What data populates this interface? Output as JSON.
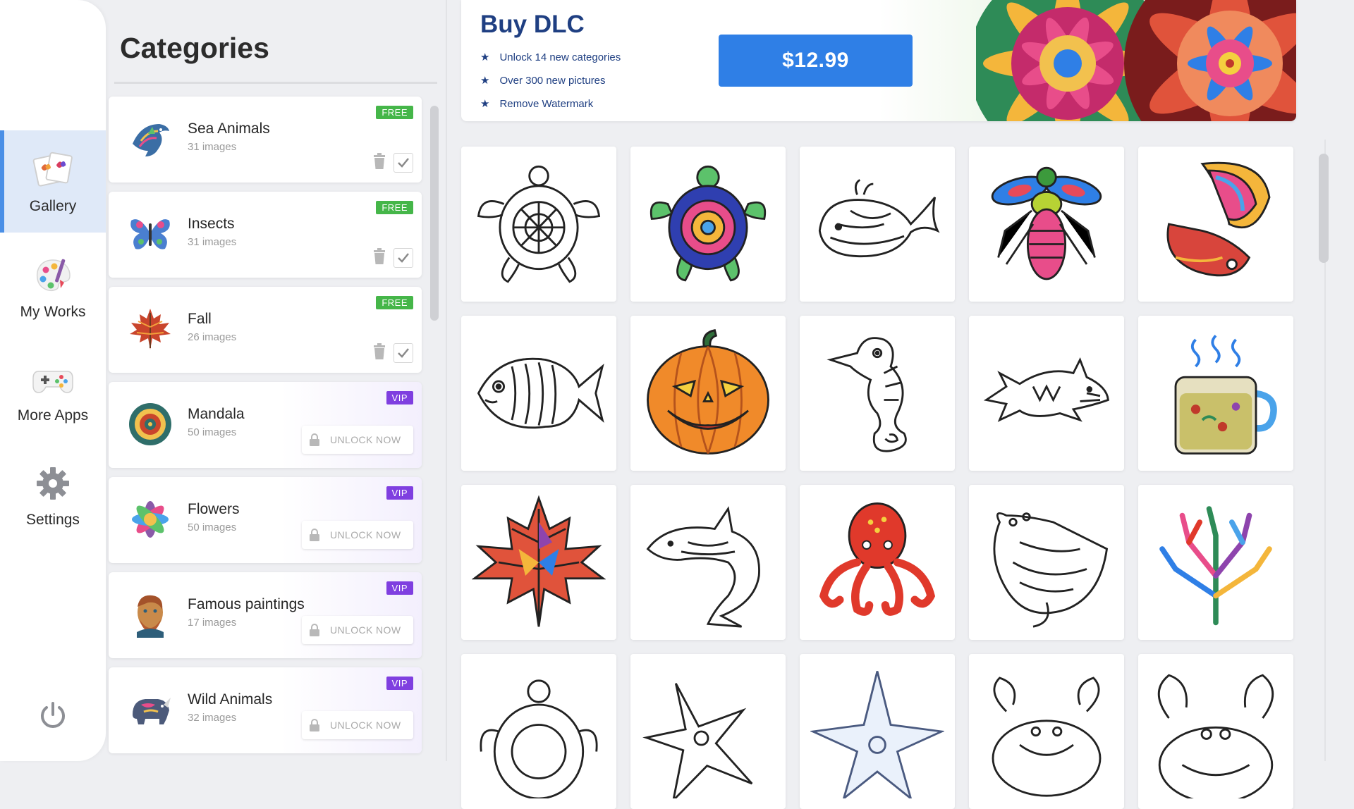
{
  "nav": {
    "items": [
      {
        "label": "Gallery",
        "icon": "gallery-icon",
        "active": true
      },
      {
        "label": "My Works",
        "icon": "palette-icon",
        "active": false
      },
      {
        "label": "More Apps",
        "icon": "gamepad-icon",
        "active": false
      },
      {
        "label": "Settings",
        "icon": "gear-icon",
        "active": false
      }
    ],
    "power_icon": "power-icon"
  },
  "categories": {
    "title": "Categories",
    "items": [
      {
        "name": "Sea Animals",
        "count": "31 images",
        "badge": "FREE",
        "thumb": "dolphin-thumb"
      },
      {
        "name": "Insects",
        "count": "31 images",
        "badge": "FREE",
        "thumb": "butterfly-thumb"
      },
      {
        "name": "Fall",
        "count": "26 images",
        "badge": "FREE",
        "thumb": "maple-leaf-thumb"
      },
      {
        "name": "Mandala",
        "count": "50 images",
        "badge": "VIP",
        "thumb": "mandala-thumb"
      },
      {
        "name": "Flowers",
        "count": "50 images",
        "badge": "VIP",
        "thumb": "flower-thumb"
      },
      {
        "name": "Famous paintings",
        "count": "17 images",
        "badge": "VIP",
        "thumb": "portrait-thumb"
      },
      {
        "name": "Wild Animals",
        "count": "32 images",
        "badge": "VIP",
        "thumb": "rhino-thumb"
      }
    ],
    "unlock_label": "UNLOCK NOW"
  },
  "dlc": {
    "title": "Buy DLC",
    "features": [
      "Unlock 14 new categories",
      "Over 300 new pictures",
      "Remove Watermark"
    ],
    "price": "$12.99"
  },
  "gallery": {
    "tiles": [
      "turtle-mandala-outline",
      "turtle-colored",
      "whale-outline",
      "bee-colored",
      "betta-fish-colored",
      "fish-outline",
      "pumpkin-colored",
      "seahorse-outline",
      "shark-outline",
      "tea-cup-colored",
      "maple-leaf-colored",
      "dolphin-outline",
      "octopus-colored",
      "manta-ray-outline",
      "coral-colored",
      "turtle-outline",
      "starfish-outline",
      "starfish-blue-outline",
      "crab-outline",
      "crab-outline-2"
    ]
  },
  "colors": {
    "accent": "#2f7fe6",
    "free_badge": "#45b649",
    "vip_badge": "#7f3fe0",
    "dlc_text": "#1f3f82",
    "active_nav": "#dfe9f8"
  }
}
